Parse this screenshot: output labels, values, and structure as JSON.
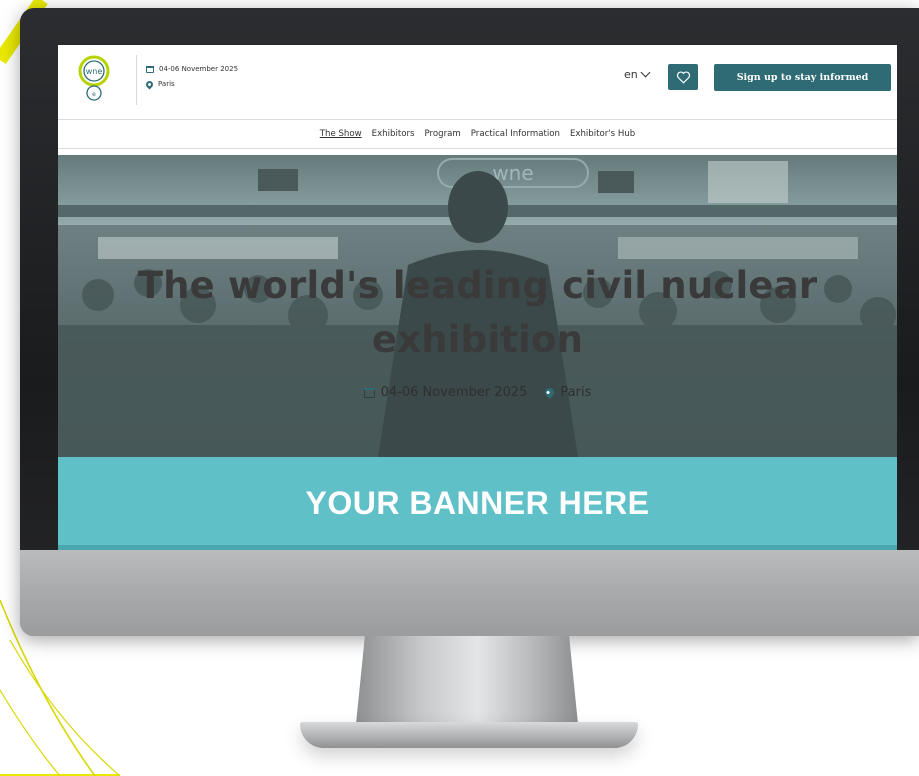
{
  "site": {
    "logo_text": "wne",
    "header_date": "04-06 November 2025",
    "header_location": "Paris",
    "language": "en",
    "signup_label": "Sign up to stay informed"
  },
  "nav": {
    "items": [
      "The Show",
      "Exhibitors",
      "Program",
      "Practical Information",
      "Exhibitor's Hub"
    ]
  },
  "hero": {
    "title_line1": "The world's leading civil nuclear",
    "title_line2": "exhibition",
    "date": "04-06 November 2025",
    "location": "Paris",
    "sign_text": "wne"
  },
  "banner": {
    "text": "YOUR BANNER HERE"
  },
  "colors": {
    "primary": "#2e6b74",
    "banner": "#5fc0c7",
    "logo_green": "#b6d300",
    "accent_yellow": "#e6e600"
  },
  "icons": [
    "calendar-icon",
    "location-pin-icon",
    "heart-icon",
    "chevron-down-icon"
  ]
}
